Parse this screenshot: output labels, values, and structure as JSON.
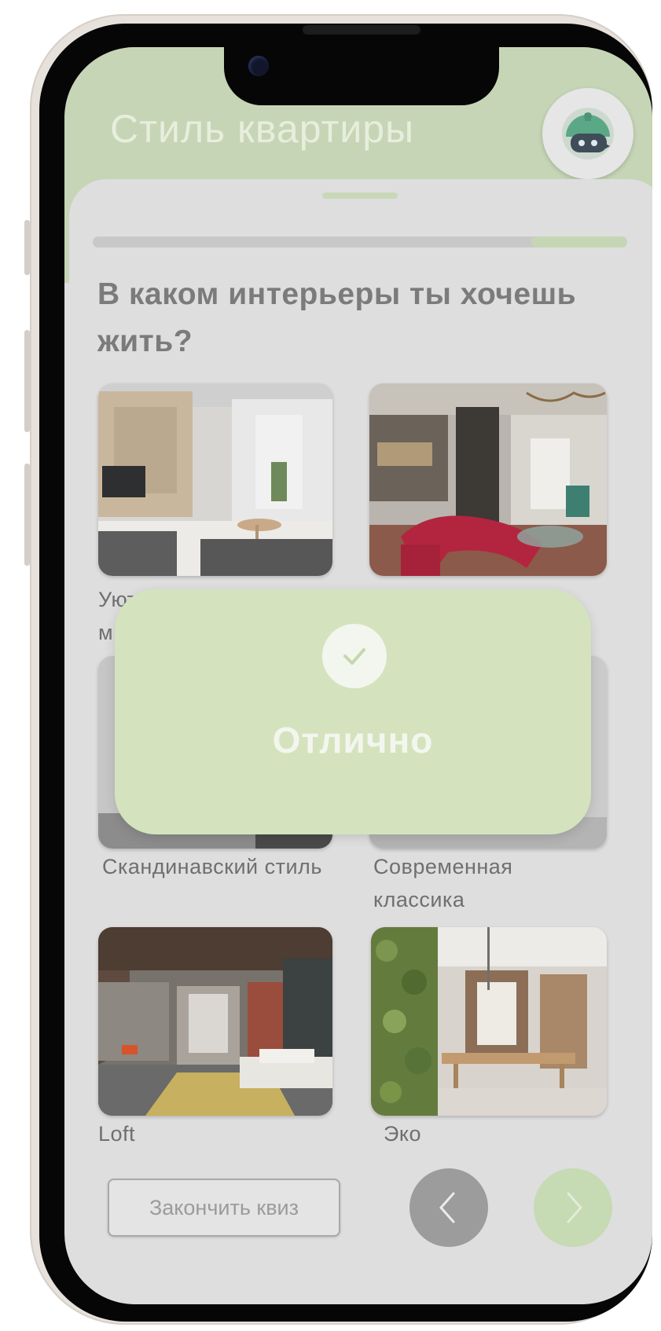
{
  "app": {
    "title": "Стиль квартиры"
  },
  "quiz": {
    "question": "В каком интерьеры ты хочешь жить?",
    "progress_fraction": 0.18,
    "options": [
      {
        "label": "Уютный минимализм"
      },
      {
        "label": ""
      },
      {
        "label": "Скандинавский стиль"
      },
      {
        "label": "Современная классика"
      },
      {
        "label": "Loft"
      },
      {
        "label": "Эко"
      }
    ]
  },
  "footer": {
    "finish_label": "Закончить квиз",
    "prev_icon": "chevron-left-icon",
    "next_icon": "chevron-right-icon"
  },
  "toast": {
    "text": "Отлично",
    "icon": "check-icon"
  },
  "colors": {
    "accent_green": "#c6d5b6",
    "toast_green": "#d4e3bd",
    "prev_button": "#9c9c9c",
    "next_button": "#c6dab4"
  }
}
